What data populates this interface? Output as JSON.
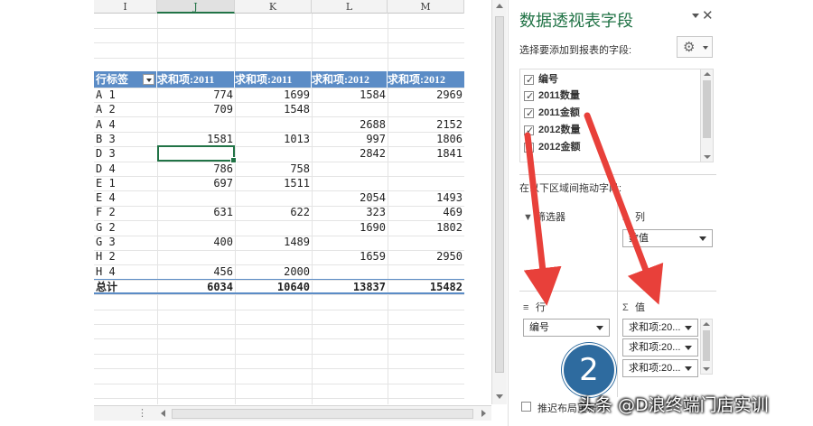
{
  "sheet": {
    "columns": [
      {
        "label": "I",
        "selected": false
      },
      {
        "label": "J",
        "selected": true
      },
      {
        "label": "K",
        "selected": false
      },
      {
        "label": "L",
        "selected": false
      },
      {
        "label": "M",
        "selected": false
      }
    ],
    "pivot": {
      "headers": [
        "行标签",
        "求和项:2011",
        "求和项:2011",
        "求和项:2012",
        "求和项:2012"
      ],
      "rows": [
        [
          "A 1",
          "774",
          "1699",
          "1584",
          "2969"
        ],
        [
          "A 2",
          "709",
          "1548",
          "",
          ""
        ],
        [
          "A 4",
          "",
          "",
          "2688",
          "2152"
        ],
        [
          "B 3",
          "1581",
          "1013",
          "997",
          "1806"
        ],
        [
          "D 3",
          "",
          "",
          "2842",
          "1841"
        ],
        [
          "D 4",
          "786",
          "758",
          "",
          ""
        ],
        [
          "E 1",
          "697",
          "1511",
          "",
          ""
        ],
        [
          "E 4",
          "",
          "",
          "2054",
          "1493"
        ],
        [
          "F 2",
          "631",
          "622",
          "323",
          "469"
        ],
        [
          "G 2",
          "",
          "",
          "1690",
          "1802"
        ],
        [
          "G 3",
          "400",
          "1489",
          "",
          ""
        ],
        [
          "H 2",
          "",
          "",
          "1659",
          "2950"
        ],
        [
          "H 4",
          "456",
          "2000",
          "",
          ""
        ]
      ],
      "total": [
        "总计",
        "6034",
        "10640",
        "13837",
        "15482"
      ]
    }
  },
  "pane": {
    "title": "数据透视表字段",
    "subtitle": "选择要添加到报表的字段:",
    "gear_icon": "gear-icon",
    "fields": [
      {
        "label": "编号",
        "checked": true
      },
      {
        "label": "2011数量",
        "checked": true
      },
      {
        "label": "2011金额",
        "checked": true
      },
      {
        "label": "2012数量",
        "checked": true
      },
      {
        "label": "2012金额",
        "checked": true
      }
    ],
    "drag_hint": "在以下区域间拖动字段:",
    "areas": {
      "filters": {
        "label": "筛选器"
      },
      "columns": {
        "label": "列",
        "items": [
          "数值"
        ]
      },
      "rows": {
        "label": "行",
        "items": [
          "编号"
        ]
      },
      "values": {
        "label": "值",
        "items": [
          "求和项:20...",
          "求和项:20...",
          "求和项:20..."
        ]
      }
    },
    "defer_label": "推迟布局更新"
  },
  "overlay": {
    "step_number": "2",
    "watermark": "头条 @D浪终端门店实训",
    "arrow_color": "#e8403a"
  }
}
